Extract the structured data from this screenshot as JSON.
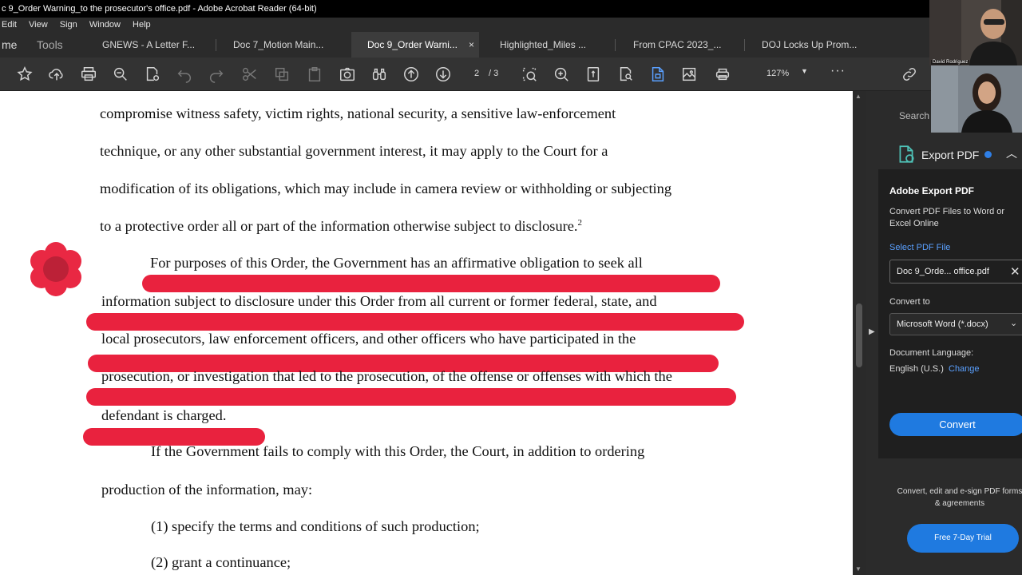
{
  "window": {
    "title": "c 9_Order Warning_to the prosecutor's office.pdf - Adobe Acrobat Reader (64-bit)"
  },
  "menu": [
    "Edit",
    "View",
    "Sign",
    "Window",
    "Help"
  ],
  "tabs": {
    "home": "me",
    "tools": "Tools",
    "docs": [
      "GNEWS - A Letter F...",
      "Doc 7_Motion Main...",
      "Doc 9_Order Warni...",
      "Highlighted_Miles ...",
      "From CPAC 2023_...",
      "DOJ Locks Up Prom..."
    ],
    "active_index": 2,
    "close_glyph": "×"
  },
  "toolbar": {
    "page_current": "2",
    "page_total": "/ 3",
    "zoom": "127%",
    "more": "···",
    "icons": [
      "star-icon",
      "upload-icon",
      "print-icon",
      "zoom-out-icon",
      "search-doc-icon",
      "undo-icon",
      "redo-icon",
      "cut-icon",
      "copy-icon",
      "paste-icon",
      "camera-icon",
      "binoculars-icon",
      "page-up-icon",
      "page-down-icon",
      "marquee-zoom-icon",
      "zoom-in-icon",
      "fit-page-icon",
      "find-icon",
      "export-icon",
      "edit-image-icon",
      "print-alt-icon",
      "link-icon"
    ]
  },
  "document": {
    "lines": [
      "compromise witness safety, victim rights, national security, a sensitive law-enforcement",
      "technique, or any other substantial government interest, it may apply to the Court for a",
      "modification of its obligations, which may include in camera review or withholding or subjecting",
      "to a protective order all or part of the information otherwise subject to disclosure.",
      "For purposes of this Order, the Government has an affirmative obligation to seek all",
      "information subject to disclosure under this Order from all current or former federal, state, and",
      "local prosecutors, law enforcement officers, and other officers who have participated in the",
      "prosecution, or investigation that led to the prosecution, of the offense or offenses with which the",
      "defendant is charged.",
      "If the Government fails to comply with this Order, the Court, in addition to ordering",
      "production of the information, may:",
      "(1) specify the terms and conditions of such production;",
      "(2) grant a continuance;"
    ],
    "footnote_mark": "2",
    "highlight_color": "#e81634"
  },
  "right_pane": {
    "search": "Search",
    "export_title": "Export PDF",
    "panel_title": "Adobe Export PDF",
    "panel_desc": "Convert PDF Files to Word or Excel Online",
    "select_file": "Select PDF File",
    "file_name": "Doc 9_Orde... office.pdf",
    "convert_to": "Convert to",
    "format": "Microsoft Word (*.docx)",
    "doc_language": "Document Language:",
    "language": "English (U.S.)",
    "change": "Change",
    "convert_button": "Convert",
    "promo": "Convert, edit and e-sign PDF forms & agreements",
    "trial_button": "Free 7-Day Trial",
    "accent": "#1f7ae0"
  },
  "cams": {
    "cam1_name": "David Rodriguez"
  }
}
